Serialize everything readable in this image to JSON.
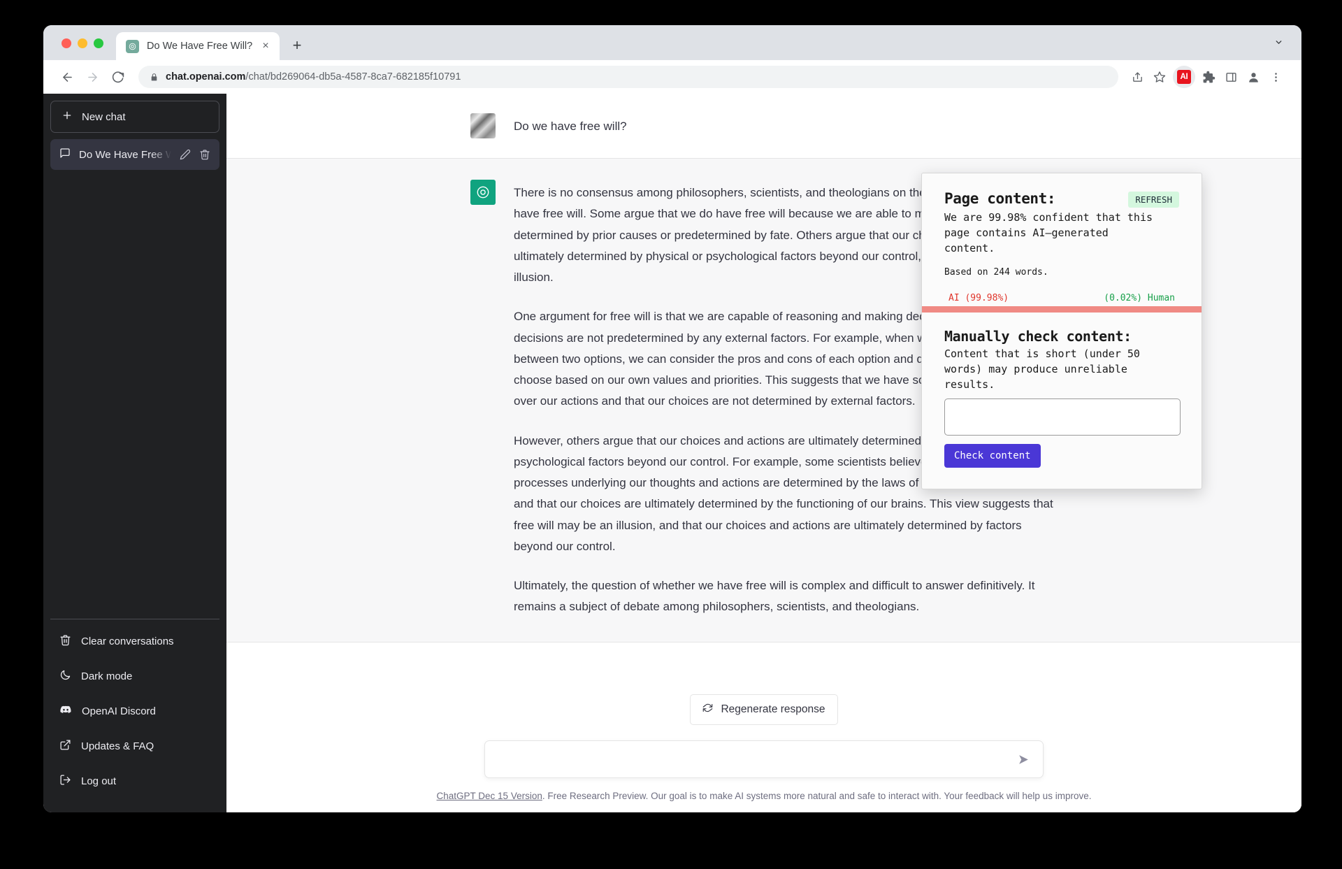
{
  "browser": {
    "tab": {
      "title": "Do We Have Free Will?",
      "favicon": "openai-logo-icon",
      "close_label": "×"
    },
    "new_tab_label": "+",
    "url_host": "chat.openai.com",
    "url_path": "/chat/bd269064-db5a-4587-8ca7-682185f10791",
    "toolbar_icons": [
      "share-icon",
      "bookmark-star-icon",
      "ai-detector-extension-icon",
      "extensions-puzzle-icon",
      "side-panel-icon",
      "profile-icon",
      "chrome-menu-icon"
    ],
    "extension_badge": "AI"
  },
  "sidebar": {
    "new_chat": "New chat",
    "conversation": {
      "title": "Do We Have Free Will?",
      "edit": "edit-icon",
      "delete": "trash-icon"
    },
    "items": [
      {
        "label": "Clear conversations",
        "icon": "trash-icon"
      },
      {
        "label": "Dark mode",
        "icon": "moon-icon"
      },
      {
        "label": "OpenAI Discord",
        "icon": "discord-icon"
      },
      {
        "label": "Updates & FAQ",
        "icon": "external-link-icon"
      },
      {
        "label": "Log out",
        "icon": "logout-icon"
      }
    ]
  },
  "chat": {
    "user_message": "Do we have free will?",
    "bot_paragraphs": [
      "There is no consensus among philosophers, scientists, and theologians on the question of whether we have free will. Some argue that we do have free will because we are able to make choices that are not determined by prior causes or predetermined by fate. Others argue that our choices and actions are ultimately determined by physical or psychological factors beyond our control, and that free will is an illusion.",
      "One argument for free will is that we are capable of reasoning and making decisions, and that these decisions are not predetermined by any external factors. For example, when we are faced with a choice between two options, we can consider the pros and cons of each option and decide which one to choose based on our own values and priorities. This suggests that we have some degree of control over our actions and that our choices are not determined by external factors.",
      "However, others argue that our choices and actions are ultimately determined by physical or psychological factors beyond our control. For example, some scientists believe that the neural processes underlying our thoughts and actions are determined by the laws of physics and chemistry, and that our choices are ultimately determined by the functioning of our brains. This view suggests that free will may be an illusion, and that our choices and actions are ultimately determined by factors beyond our control.",
      "Ultimately, the question of whether we have free will is complex and difficult to answer definitively. It remains a subject of debate among philosophers, scientists, and theologians."
    ]
  },
  "composer": {
    "regenerate_label": "Regenerate response",
    "input_value": "",
    "input_placeholder": "",
    "send_icon": "send-arrow-icon"
  },
  "footer": {
    "version_link": "ChatGPT Dec 15 Version",
    "rest": ". Free Research Preview. Our goal is to make AI systems more natural and safe to interact with. Your feedback will help us improve."
  },
  "detector": {
    "page_content_title": "Page content:",
    "refresh_label": "REFRESH",
    "confidence_text": "We are 99.98% confident that this page contains AI–generated content.",
    "word_basis": "Based on 244 words.",
    "ai_score_label": "AI (99.98%)",
    "human_score_label": "(0.02%) Human",
    "ai_percent": 99.98,
    "human_percent": 0.02,
    "bar_color": "#f08a84",
    "manual_title": "Manually check content:",
    "manual_desc": "Content that is short (under 50 words) may produce unreliable results.",
    "manual_value": "",
    "manual_placeholder": "",
    "check_button": "Check content",
    "check_button_color": "#4a37d6"
  }
}
